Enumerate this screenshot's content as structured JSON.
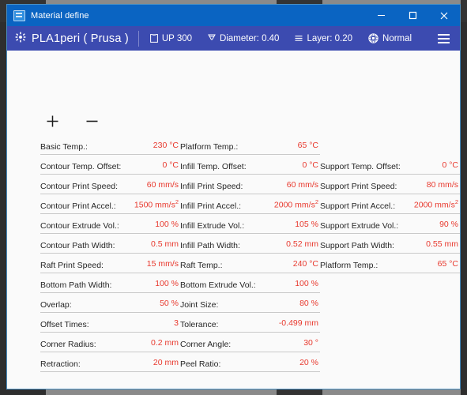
{
  "window": {
    "title": "Material define",
    "title_icon": "app-icon",
    "controls": {
      "minimize": "minimize-icon",
      "maximize": "maximize-icon",
      "close": "close-icon"
    }
  },
  "toolbar": {
    "material_icon": "material-gear-icon",
    "material_name": "PLA1peri ( Prusa )",
    "items": [
      {
        "icon": "printer-icon",
        "label": "UP 300"
      },
      {
        "icon": "nozzle-icon",
        "label": "Diameter: 0.40"
      },
      {
        "icon": "layer-icon",
        "label": "Layer: 0.20"
      },
      {
        "icon": "quality-icon",
        "label": "Normal"
      }
    ],
    "menu_icon": "hamburger-icon"
  },
  "actions": {
    "add_label": "+",
    "remove_label": "−"
  },
  "columns": [
    {
      "name": "contour",
      "fields": [
        {
          "label": "Basic Temp.:",
          "value": "230 °C"
        },
        {
          "label": "Contour Temp. Offset:",
          "value": "0 °C"
        },
        {
          "label": "Contour Print Speed:",
          "value": "60 mm/s"
        },
        {
          "label": "Contour Print Accel.:",
          "value": "1500 mm/s²"
        },
        {
          "label": "Contour Extrude Vol.:",
          "value": "100 %"
        },
        {
          "label": "Contour Path Width:",
          "value": "0.5 mm"
        },
        {
          "label": "Raft Print Speed:",
          "value": "15 mm/s"
        },
        {
          "label": "Bottom Path Width:",
          "value": "100 %"
        },
        {
          "label": "Overlap:",
          "value": "50 %"
        },
        {
          "label": "Offset Times:",
          "value": "3"
        },
        {
          "label": "Corner Radius:",
          "value": "0.2 mm"
        },
        {
          "label": "Retraction:",
          "value": "20 mm"
        }
      ]
    },
    {
      "name": "infill",
      "fields": [
        {
          "label": "Platform Temp.:",
          "value": "65 °C"
        },
        {
          "label": "Infill Temp. Offset:",
          "value": "0 °C"
        },
        {
          "label": "Infill Print Speed:",
          "value": "60 mm/s"
        },
        {
          "label": "Infill Print Accel.:",
          "value": "2000 mm/s²"
        },
        {
          "label": "Infill Extrude Vol.:",
          "value": "105 %"
        },
        {
          "label": "Infill Path Width:",
          "value": "0.52 mm"
        },
        {
          "label": "Raft Temp.:",
          "value": "240 °C"
        },
        {
          "label": "Bottom Extrude Vol.:",
          "value": "100 %"
        },
        {
          "label": "Joint Size:",
          "value": "80 %"
        },
        {
          "label": "Tolerance:",
          "value": "-0.499 mm"
        },
        {
          "label": "Corner Angle:",
          "value": "30 °"
        },
        {
          "label": "Peel Ratio:",
          "value": "20 %"
        }
      ]
    },
    {
      "name": "support",
      "fields": [
        {
          "label": "",
          "value": ""
        },
        {
          "label": "Support Temp. Offset:",
          "value": "0 °C"
        },
        {
          "label": "Support Print Speed:",
          "value": "80 mm/s"
        },
        {
          "label": "Support Print Accel.:",
          "value": "2000 mm/s²"
        },
        {
          "label": "Support Extrude Vol.:",
          "value": "90 %"
        },
        {
          "label": "Support Path Width:",
          "value": "0.55 mm"
        },
        {
          "label": "Platform Temp.:",
          "value": "65 °C"
        }
      ]
    }
  ],
  "colors": {
    "titlebar": "#0a64c2",
    "toolbar": "#3c4bb0",
    "value_text": "#e8392e",
    "content_bg": "#fafafa",
    "window_border": "#4a90c4"
  }
}
